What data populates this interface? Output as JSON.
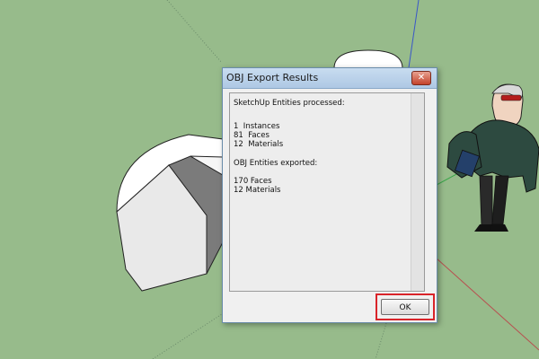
{
  "dialog": {
    "title": "OBJ Export Results",
    "close_symbol": "✕",
    "ok_label": "OK"
  },
  "results": {
    "processed_heading": "SketchUp Entities processed:",
    "processed_items": [
      "1  Instances",
      "81  Faces",
      "12  Materials"
    ],
    "exported_heading": "OBJ Entities exported:",
    "exported_items": [
      "170 Faces",
      "12 Materials"
    ]
  },
  "colors": {
    "canvas_background": "#97bb8b",
    "highlight_border": "#d9242a",
    "axis_blue": "#3a57c8",
    "axis_red": "#b85050",
    "axis_green": "#3aa64a"
  },
  "icons": {
    "close": "close-icon"
  }
}
